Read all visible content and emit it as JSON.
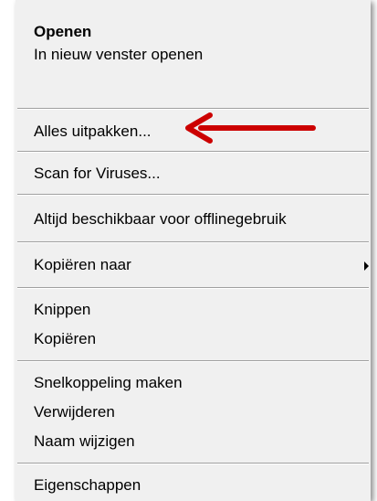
{
  "menu": {
    "items": [
      {
        "label": "Openen",
        "bold": true
      },
      {
        "label": "In nieuw venster openen"
      },
      {
        "label": "Alles uitpakken..."
      },
      {
        "label": "Scan for Viruses..."
      },
      {
        "label": "Altijd beschikbaar voor offlinegebruik"
      },
      {
        "label": "Kopiëren naar",
        "submenu": true
      },
      {
        "label": "Knippen"
      },
      {
        "label": "Kopiëren"
      },
      {
        "label": "Snelkoppeling maken"
      },
      {
        "label": "Verwijderen"
      },
      {
        "label": "Naam wijzigen"
      },
      {
        "label": "Eigenschappen"
      }
    ]
  },
  "annotation": {
    "arrow_color": "#cc0000"
  }
}
